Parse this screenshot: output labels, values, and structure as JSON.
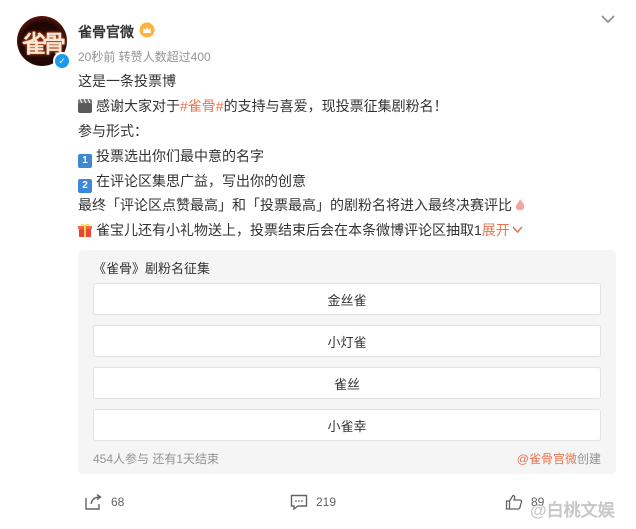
{
  "post": {
    "author": "雀骨官微",
    "meta": "20秒前 转赞人数超过400",
    "lines": {
      "l1": "这是一条投票博",
      "l2_pre": "感谢大家对于",
      "l2_topic": "#雀骨#",
      "l2_post": "的支持与喜爱，现投票征集剧粉名！",
      "l3": "参与形式：",
      "l4_num": "1",
      "l4": "投票选出你们最中意的名字",
      "l5_num": "2",
      "l5": "在评论区集思广益，写出你的创意",
      "l6": "最终「评论区点赞最高」和「投票最高」的剧粉名将进入最终决赛评比",
      "l7": "雀宝儿还有小礼物送上，投票结束后会在本条微博评论区抽取1",
      "expand": "展开"
    }
  },
  "poll": {
    "title": "《雀骨》剧粉名征集",
    "options": [
      "金丝雀",
      "小灯雀",
      "雀丝",
      "小雀幸"
    ],
    "footer_left": "454人参与 还有1天结束",
    "creator": "@雀骨官微",
    "creator_suffix": "创建"
  },
  "actions": {
    "share_count": "68",
    "comment_count": "219",
    "like_count": "89"
  },
  "watermark": "@白桃文娱",
  "colors": {
    "accent": "#eb7350",
    "verify": "#1a9bf0",
    "poll_bg": "#f5f5f5"
  },
  "icons": [
    "verified-icon",
    "vip-crown-icon",
    "chevron-down-icon",
    "clapper-icon",
    "keycap-1-icon",
    "keycap-2-icon",
    "gift-icon",
    "fire-icon",
    "share-icon",
    "comment-icon",
    "like-icon"
  ]
}
